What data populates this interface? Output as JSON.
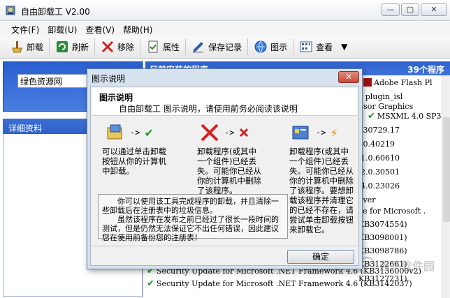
{
  "window": {
    "title": "自由卸载工 V2.00"
  },
  "menu": [
    "文件(F)",
    "卸载(U)",
    "查看(V)",
    "帮助(H)"
  ],
  "toolbar": {
    "uninstall": "卸载",
    "refresh": "刷新",
    "remove": "移除",
    "properties": "属性",
    "save_log": "保存记录",
    "legend": "图示",
    "view": "查看"
  },
  "left": {
    "search_value": "绿色资源网",
    "detail_title": "详细资料"
  },
  "right": {
    "header_title": "目前安装的程序",
    "program_count": "39个程序"
  },
  "list_rows": [
    "Adobe Flash Pl",
    "y plugin_isl",
    "essor Graphics",
    "MSXML 4.0 SP3",
    ".30729.17",
    ".0.40219",
    "1.0.60610",
    "2.0.30501",
    "4.0.23026",
    "iver",
    "ce for Microsoft .",
    "KB3074554)",
    "KB3098001)",
    "KB3098786)",
    "KB3122661)",
    "KB3127231)",
    "Security Update for Microsoft .NET Framework 4.6 (KB3136000v2)",
    "Security Update for Microsoft .NET Framework 4.6 (KB3142037)"
  ],
  "dialog": {
    "title": "图示说明",
    "heading": "图示说明",
    "subtitle": "自由卸载工 图示说明，请使用前务必阅读该说明",
    "arrow": "->",
    "desc1": "可以通过单击卸载按钮从你的计算机中卸载。",
    "desc2": "卸载程序(或其中一个组件)已经丢失。可能你已经从你的计算机中删除了该程序。",
    "desc3": "卸载程序(或其中一个组件)已经丢失。可能你已经从你的计算机中删除了该程序。要想卸载该程序并清理它的已经不存在，请尝试单击卸载按钮来卸载它。",
    "note1": "你可以使用该工具完成程序的卸载，并且清除一些卸载后在注册表中的垃圾信息。",
    "note2": "虽然该程序在发布之前已经过了很长一段时间的测试，但是仍然无法保证它不出任何错误，因此建议您在使用前备份您的注册表！",
    "ok": "确定"
  },
  "watermark": "当下软件园"
}
